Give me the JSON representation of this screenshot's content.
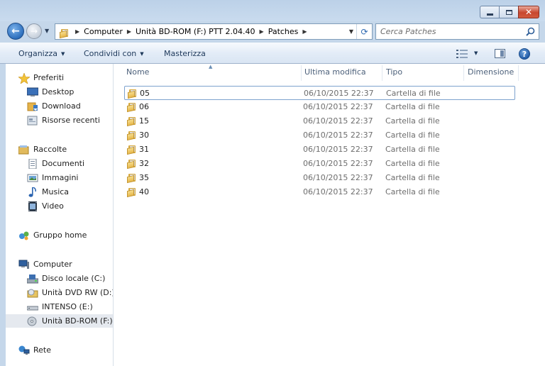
{
  "address": {
    "crumbs": [
      "Computer",
      "Unità BD-ROM (F:) PTT 2.04.40",
      "Patches"
    ]
  },
  "search": {
    "placeholder": "Cerca Patches"
  },
  "toolbar": {
    "organize": "Organizza",
    "share": "Condividi con",
    "burn": "Masterizza"
  },
  "sidebar": {
    "favorites": "Preferiti",
    "desktop": "Desktop",
    "download": "Download",
    "recent": "Risorse recenti",
    "libraries": "Raccolte",
    "documents": "Documenti",
    "pictures": "Immagini",
    "music": "Musica",
    "video": "Video",
    "homegroup": "Gruppo home",
    "computer": "Computer",
    "drive_c": "Disco locale (C:)",
    "drive_d": "Unità DVD RW (D:) C",
    "drive_e": "INTENSO (E:)",
    "drive_f": "Unità BD-ROM (F:) P",
    "network": "Rete"
  },
  "columns": {
    "name": "Nome",
    "modified": "Ultima modifica",
    "type": "Tipo",
    "size": "Dimensione"
  },
  "files": [
    {
      "name": "05",
      "modified": "06/10/2015 22:37",
      "type": "Cartella di file"
    },
    {
      "name": "06",
      "modified": "06/10/2015 22:37",
      "type": "Cartella di file"
    },
    {
      "name": "15",
      "modified": "06/10/2015 22:37",
      "type": "Cartella di file"
    },
    {
      "name": "30",
      "modified": "06/10/2015 22:37",
      "type": "Cartella di file"
    },
    {
      "name": "31",
      "modified": "06/10/2015 22:37",
      "type": "Cartella di file"
    },
    {
      "name": "32",
      "modified": "06/10/2015 22:37",
      "type": "Cartella di file"
    },
    {
      "name": "35",
      "modified": "06/10/2015 22:37",
      "type": "Cartella di file"
    },
    {
      "name": "40",
      "modified": "06/10/2015 22:37",
      "type": "Cartella di file"
    }
  ]
}
